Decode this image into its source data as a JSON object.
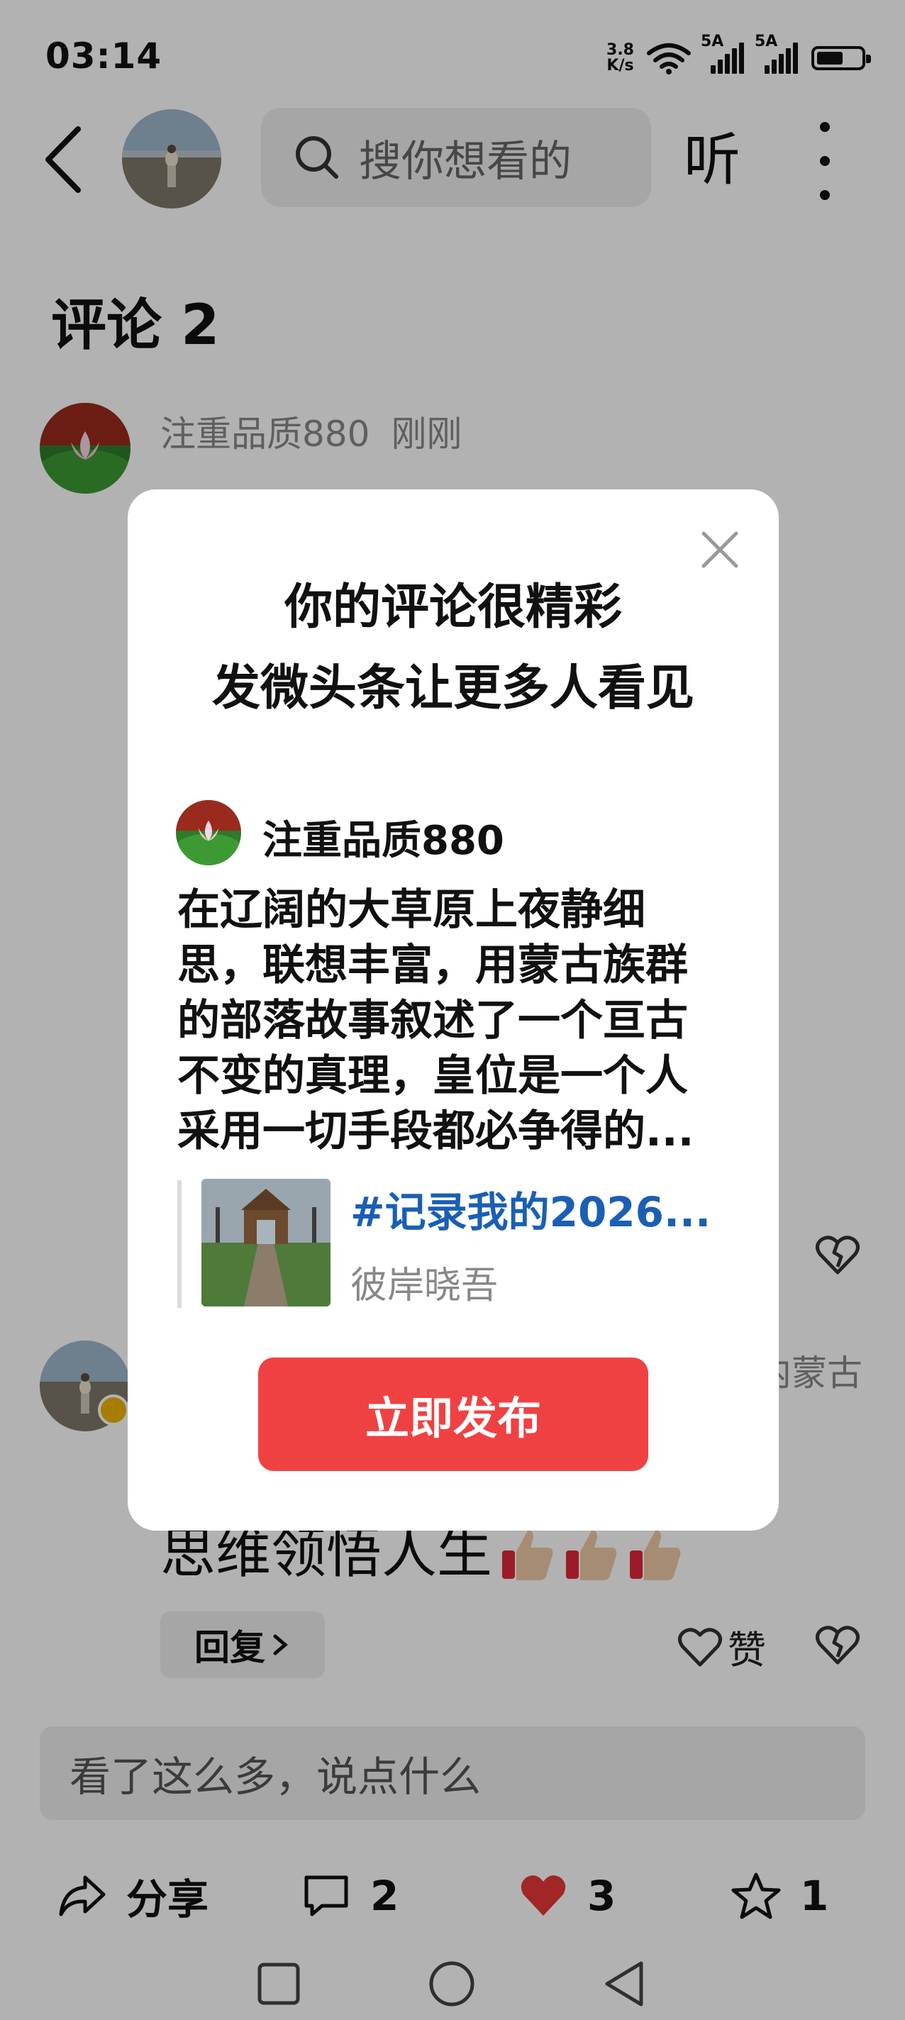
{
  "status_bar": {
    "time": "03:14",
    "net_speed_value": "3.8",
    "net_speed_unit": "K/s",
    "signal1_label": "5A",
    "signal2_label": "5A",
    "battery_level": 0.62
  },
  "header": {
    "search_placeholder": "搜你想看的",
    "listen_label": "听"
  },
  "comments": {
    "title": "评论 2",
    "items": [
      {
        "author": "注重品质880",
        "time": "刚刚"
      },
      {
        "location_fragment": "内蒙古",
        "line2": "思维领悟人生",
        "reply_label": "回复",
        "like_label": "赞"
      }
    ]
  },
  "comment_input": {
    "placeholder": "看了这么多，说点什么"
  },
  "actions": {
    "share_label": "分享",
    "comment_count": "2",
    "like_count": "3",
    "favorite_count": "1"
  },
  "dialog": {
    "title_line1": "你的评论很精彩",
    "title_line2": "发微头条让更多人看见",
    "user": "注重品质880",
    "text": "在辽阔的大草原上夜静细思，联想丰富，用蒙古族群的部落故事叙述了一个亘古不变的真理，皇位是一个人采用一切手段都必争得的...",
    "quote_title": "#记录我的2026...",
    "quote_author": "彼岸晓吾",
    "publish_label": "立即发布"
  },
  "colors": {
    "accent_red": "#f04142",
    "link_blue": "#1a5fb4",
    "heart_red": "#e53935"
  },
  "icons": [
    "back-icon",
    "search-icon",
    "more-icon",
    "close-icon",
    "broken-heart-icon",
    "heart-icon",
    "share-icon",
    "comment-icon",
    "star-icon",
    "square-nav-icon",
    "circle-nav-icon",
    "triangle-nav-icon"
  ]
}
